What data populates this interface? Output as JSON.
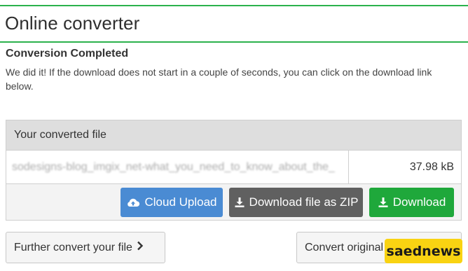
{
  "header": {
    "title": "Online converter",
    "accent_color": "#2bb24c"
  },
  "status": {
    "heading": "Conversion Completed",
    "message": "We did it! If the download does not start in a couple of seconds, you can click on the download link below."
  },
  "file_panel": {
    "header": "Your converted file",
    "file_name": "sodesigns-blog_imgix_net-what_you_need_to_know_about_the_",
    "file_size": "37.98 kB"
  },
  "actions": {
    "cloud_upload": {
      "label": "Cloud Upload",
      "icon": "cloud-upload-icon",
      "color": "#4a8bd3"
    },
    "download_zip": {
      "label": "Download file as ZIP",
      "icon": "download-icon",
      "color": "#606060"
    },
    "download": {
      "label": "Download",
      "icon": "download-icon",
      "color": "#1fa83b"
    }
  },
  "footer": {
    "further_convert": "Further convert your file",
    "further_icon": "chevron-right-icon",
    "convert_original": "Convert original"
  },
  "watermark": {
    "text": "saednews",
    "color": "#f9d312"
  }
}
